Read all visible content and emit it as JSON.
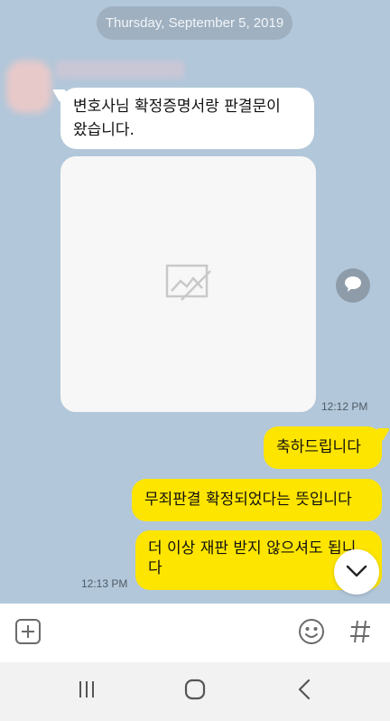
{
  "chat": {
    "date_divider": "Thursday, September 5, 2019",
    "messages": [
      {
        "side": "in",
        "text_line1": "변호사님 확정증명서랑 판결문이",
        "text_line2": "왔습니다."
      },
      {
        "side": "in",
        "type": "image",
        "time": "12:12 PM"
      },
      {
        "side": "out",
        "text": "축하드립니다"
      },
      {
        "side": "out",
        "text": "무죄판결 확정되었다는 뜻입니다"
      },
      {
        "side": "out",
        "text_line1": "더 이상 재판 받지 않으셔도 됩니",
        "text_line2": "다",
        "time": "12:13 PM"
      }
    ]
  },
  "icons": {
    "image_placeholder": "image-placeholder-icon",
    "share": "share-speech-icon",
    "scroll_down": "chevron-down-icon",
    "attach": "plus-square-icon",
    "emoji": "smiley-icon",
    "hashtag": "hashtag-icon",
    "nav_recents": "recents-icon",
    "nav_home": "home-icon",
    "nav_back": "back-icon"
  },
  "colors": {
    "chat_background": "#b2c7da",
    "incoming_bubble": "#ffffff",
    "outgoing_bubble": "#fee500",
    "date_pill": "#9fb0c0"
  }
}
